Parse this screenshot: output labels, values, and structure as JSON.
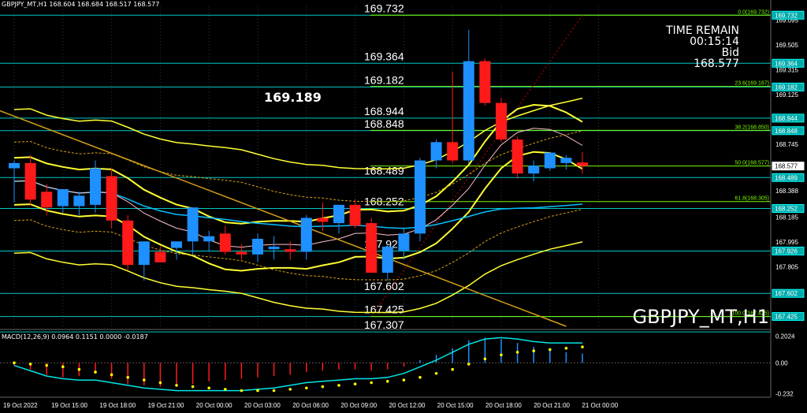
{
  "header": {
    "text": "GBPJPY_MT,H1  168.604 168.684 168.517 168.577"
  },
  "timer": {
    "label": "TIME REMAIN",
    "time": "00:15:14",
    "bid_label": "Bid",
    "bid": "168.577"
  },
  "big_price": "169.189",
  "symbol": "GBPJPY_MT,H1",
  "macd_label": "MACD(12,26,9) 0.0964 0.1151 0.0000 -0.0187",
  "colors": {
    "bull": "#1e90ff",
    "bear": "#ff1a1a",
    "level": "#00c8c8",
    "fib": "#7cfc00",
    "yellow": "#ffff33",
    "gold": "#d4a017",
    "pink": "#ffc0cb",
    "ma": "#00bfff",
    "macd_line": "#00e5e5",
    "macd_signal": "#ffff00"
  },
  "chart_data": {
    "type": "candlestick",
    "price_axis": {
      "ylim": [
        167.35,
        169.8
      ],
      "ticks": [
        "169.095",
        "169.505",
        "169.315",
        "169.125",
        "168.745",
        "168.388",
        "168.185",
        "167.995",
        "167.805"
      ]
    },
    "x_ticks": [
      "19 Oct 2022",
      "19 Oct 15:00",
      "19 Oct 18:00",
      "19 Oct 21:00",
      "20 Oct 00:00",
      "20 Oct 03:00",
      "20 Oct 06:00",
      "20 Oct 09:00",
      "20 Oct 12:00",
      "20 Oct 15:00",
      "20 Oct 18:00",
      "20 Oct 21:00",
      "21 Oct 00:00"
    ],
    "candles": [
      {
        "o": 168.56,
        "h": 168.62,
        "l": 168.3,
        "c": 168.6
      },
      {
        "o": 168.6,
        "h": 168.66,
        "l": 168.28,
        "c": 168.32
      },
      {
        "o": 168.38,
        "h": 168.44,
        "l": 168.2,
        "c": 168.26
      },
      {
        "o": 168.27,
        "h": 168.4,
        "l": 168.22,
        "c": 168.4
      },
      {
        "o": 168.27,
        "h": 168.38,
        "l": 168.2,
        "c": 168.35
      },
      {
        "o": 168.28,
        "h": 168.62,
        "l": 168.22,
        "c": 168.56
      },
      {
        "o": 168.5,
        "h": 168.56,
        "l": 168.1,
        "c": 168.16
      },
      {
        "o": 168.16,
        "h": 168.2,
        "l": 167.78,
        "c": 167.82
      },
      {
        "o": 167.82,
        "h": 168.0,
        "l": 167.7,
        "c": 168.0
      },
      {
        "o": 167.92,
        "h": 167.96,
        "l": 167.84,
        "c": 167.84
      },
      {
        "o": 167.95,
        "h": 168.0,
        "l": 167.86,
        "c": 168.0
      },
      {
        "o": 168.0,
        "h": 168.26,
        "l": 167.9,
        "c": 168.26
      },
      {
        "o": 168.0,
        "h": 168.08,
        "l": 167.92,
        "c": 168.04
      },
      {
        "o": 168.06,
        "h": 168.12,
        "l": 167.9,
        "c": 167.92
      },
      {
        "o": 167.92,
        "h": 167.98,
        "l": 167.86,
        "c": 167.9
      },
      {
        "o": 167.9,
        "h": 168.06,
        "l": 167.84,
        "c": 168.02
      },
      {
        "o": 167.94,
        "h": 168.04,
        "l": 167.86,
        "c": 167.96
      },
      {
        "o": 167.94,
        "h": 168.0,
        "l": 167.86,
        "c": 167.92
      },
      {
        "o": 167.92,
        "h": 168.2,
        "l": 167.86,
        "c": 168.18
      },
      {
        "o": 168.18,
        "h": 168.3,
        "l": 168.08,
        "c": 168.15
      },
      {
        "o": 168.14,
        "h": 168.28,
        "l": 168.06,
        "c": 168.28
      },
      {
        "o": 168.28,
        "h": 168.32,
        "l": 168.1,
        "c": 168.12
      },
      {
        "o": 168.14,
        "h": 168.18,
        "l": 167.76,
        "c": 167.76
      },
      {
        "o": 167.76,
        "h": 167.98,
        "l": 167.7,
        "c": 167.96
      },
      {
        "o": 167.93,
        "h": 168.1,
        "l": 167.86,
        "c": 168.06
      },
      {
        "o": 168.06,
        "h": 168.64,
        "l": 168.0,
        "c": 168.62
      },
      {
        "o": 168.62,
        "h": 168.78,
        "l": 168.56,
        "c": 168.76
      },
      {
        "o": 168.76,
        "h": 169.3,
        "l": 168.6,
        "c": 168.62
      },
      {
        "o": 168.62,
        "h": 169.62,
        "l": 168.6,
        "c": 169.38
      },
      {
        "o": 169.38,
        "h": 169.4,
        "l": 169.04,
        "c": 169.06
      },
      {
        "o": 169.06,
        "h": 169.1,
        "l": 168.76,
        "c": 168.78
      },
      {
        "o": 168.78,
        "h": 168.8,
        "l": 168.48,
        "c": 168.52
      },
      {
        "o": 168.52,
        "h": 168.62,
        "l": 168.46,
        "c": 168.58
      },
      {
        "o": 168.56,
        "h": 168.68,
        "l": 168.54,
        "c": 168.68
      },
      {
        "o": 168.6,
        "h": 168.66,
        "l": 168.55,
        "c": 168.64
      },
      {
        "o": 168.604,
        "h": 168.684,
        "l": 168.517,
        "c": 168.577
      }
    ],
    "horizontal_levels": [
      {
        "price": 169.732,
        "label": "169.732"
      },
      {
        "price": 169.364,
        "label": "169.364"
      },
      {
        "price": 169.182,
        "label": "169.182"
      },
      {
        "price": 168.944,
        "label": "168.944"
      },
      {
        "price": 168.848,
        "label": "168.848"
      },
      {
        "price": 168.489,
        "label": "168.489"
      },
      {
        "price": 168.252,
        "label": "168.252"
      },
      {
        "price": 167.926,
        "label": "167.926"
      },
      {
        "price": 167.602,
        "label": "167.602"
      },
      {
        "price": 167.425,
        "label": "167.425"
      },
      {
        "price": 167.307,
        "label": "167.307"
      }
    ],
    "fib_levels": [
      {
        "price": 169.732,
        "label": "0.0(169.732)"
      },
      {
        "price": 169.187,
        "label": "23.6(169.187)"
      },
      {
        "price": 168.85,
        "label": "38.2(168.850)"
      },
      {
        "price": 168.577,
        "label": "50.0(168.577)"
      },
      {
        "price": 168.305,
        "label": "61.8(168.305)"
      },
      {
        "price": 167.425,
        "label": "100.0(167.425)"
      }
    ],
    "price_tags": [
      "169.732",
      "169.364",
      "169.182",
      "168.944",
      "168.848",
      "168.577",
      "168.489",
      "168.252",
      "167.926",
      "167.602",
      "167.425"
    ],
    "macd": {
      "ylim": [
        -0.26,
        0.24
      ],
      "ticks": [
        "0.2024",
        "0.00",
        "-0.232"
      ],
      "histogram": [
        -0.02,
        -0.05,
        -0.09,
        -0.11,
        -0.1,
        -0.08,
        -0.12,
        -0.16,
        -0.17,
        -0.18,
        -0.18,
        -0.16,
        -0.14,
        -0.13,
        -0.12,
        -0.11,
        -0.1,
        -0.09,
        -0.07,
        -0.06,
        -0.05,
        -0.05,
        -0.06,
        -0.05,
        -0.03,
        0.02,
        0.06,
        0.11,
        0.17,
        0.19,
        0.18,
        0.15,
        0.12,
        0.1,
        0.08,
        0.07
      ],
      "macd_line": [
        -0.02,
        -0.06,
        -0.1,
        -0.12,
        -0.13,
        -0.13,
        -0.15,
        -0.17,
        -0.19,
        -0.2,
        -0.21,
        -0.21,
        -0.21,
        -0.21,
        -0.21,
        -0.2,
        -0.19,
        -0.17,
        -0.15,
        -0.14,
        -0.13,
        -0.12,
        -0.12,
        -0.11,
        -0.08,
        -0.03,
        0.02,
        0.08,
        0.14,
        0.18,
        0.19,
        0.18,
        0.16,
        0.15,
        0.15,
        0.15
      ],
      "signal": [
        0.0,
        -0.01,
        -0.02,
        -0.03,
        -0.05,
        -0.07,
        -0.09,
        -0.11,
        -0.13,
        -0.15,
        -0.17,
        -0.18,
        -0.19,
        -0.2,
        -0.21,
        -0.21,
        -0.21,
        -0.2,
        -0.19,
        -0.18,
        -0.17,
        -0.16,
        -0.15,
        -0.14,
        -0.13,
        -0.11,
        -0.08,
        -0.05,
        -0.01,
        0.03,
        0.06,
        0.08,
        0.09,
        0.1,
        0.11,
        0.12
      ]
    }
  }
}
